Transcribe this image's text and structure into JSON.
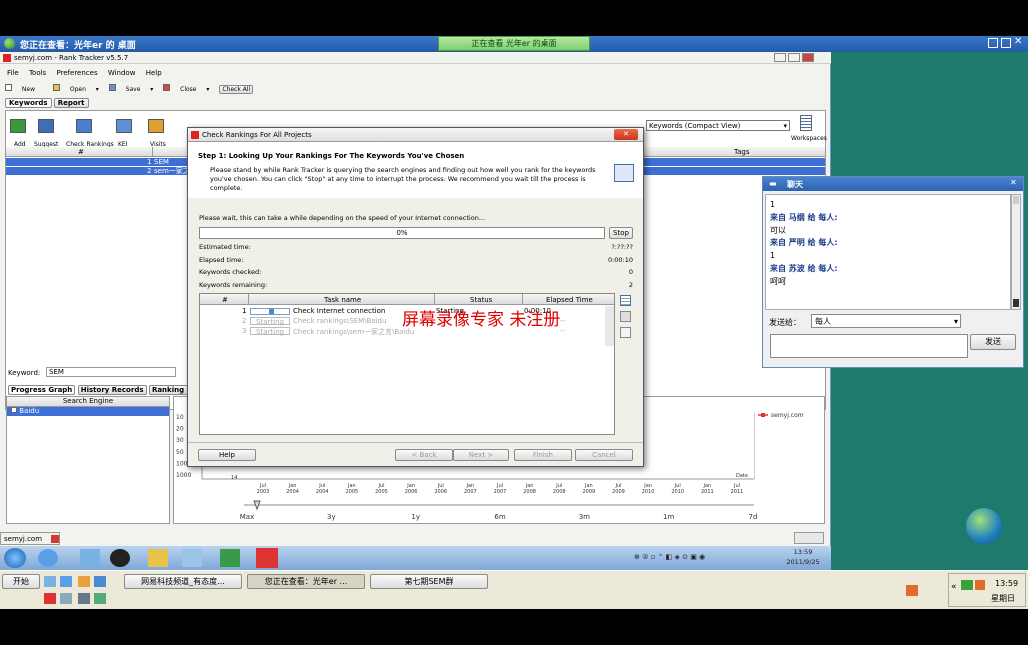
{
  "remote": {
    "title": "您正在查看：光年er 的 桌面",
    "banner": "正在查看 光年er 的桌面"
  },
  "app": {
    "title": "semyj.com - Rank Tracker v5.5.7",
    "menu": [
      "File",
      "Tools",
      "Preferences",
      "Window",
      "Help"
    ],
    "toolbar": [
      "New",
      "Open",
      "Save",
      "Close",
      "Check All"
    ],
    "tabs": [
      "Keywords",
      "Report"
    ],
    "tool_buttons": [
      "Add",
      "Suggest",
      "Check Rankings",
      "KEI",
      "Visits"
    ],
    "view_select": "Keywords (Compact View)",
    "workspaces_label": "Workspaces",
    "grid_headers": {
      "num": "#",
      "tags": "Tags"
    },
    "rows": [
      {
        "num": "1",
        "keyword": "SEM"
      },
      {
        "num": "2",
        "keyword": "sem一家之言"
      }
    ],
    "keyword_label": "Keyword:",
    "keyword_value": "SEM",
    "bottom_tabs": [
      "Progress Graph",
      "History Records",
      "Ranking Data"
    ],
    "search_engine_header": "Search Engine",
    "search_engine_item": "Baidu",
    "chart": {
      "y_ticks": [
        "10",
        "20",
        "30",
        "50",
        "100",
        "1000"
      ],
      "x_ticks": [
        [
          "Jul",
          "2003"
        ],
        [
          "Jan",
          "2004"
        ],
        [
          "Jul",
          "2004"
        ],
        [
          "Jan",
          "2005"
        ],
        [
          "Jul",
          "2005"
        ],
        [
          "Jan",
          "2006"
        ],
        [
          "Jul",
          "2006"
        ],
        [
          "Jan",
          "2007"
        ],
        [
          "Jul",
          "2007"
        ],
        [
          "Jan",
          "2008"
        ],
        [
          "Jul",
          "2008"
        ],
        [
          "Jan",
          "2009"
        ],
        [
          "Jul",
          "2009"
        ],
        [
          "Jan",
          "2010"
        ],
        [
          "Jul",
          "2010"
        ],
        [
          "Jan",
          "2011"
        ],
        [
          "Jul",
          "2011"
        ]
      ],
      "legend": "semyj.com",
      "x_axis_note": "Date",
      "range_labels": [
        "Max",
        "3y",
        "1y",
        "6m",
        "3m",
        "1m",
        "7d"
      ],
      "slider_left_value": "14"
    },
    "status_tab": "semyj.com"
  },
  "dialog": {
    "title": "Check Rankings For All Projects",
    "step_title": "Step 1: Looking Up Your Rankings For The Keywords You've Chosen",
    "description": "Please stand by while Rank Tracker is querying the search engines and finding out how well you rank for the keywords you've chosen. You can click \"Stop\" at any time to interrupt the process. We recommend you wait till the process is complete.",
    "wait_text": "Please wait, this can take a while depending on the speed of your Internet connection...",
    "progress_text": "0%",
    "progress": 0,
    "stop_label": "Stop",
    "stats": [
      {
        "label": "Estimated time:",
        "value": "?:??:??"
      },
      {
        "label": "Elapsed time:",
        "value": "0:00:10"
      },
      {
        "label": "Keywords checked:",
        "value": "0"
      },
      {
        "label": "Keywords remaining:",
        "value": "2"
      }
    ],
    "table_headers": [
      "#",
      "Task name",
      "Status",
      "Elapsed Time"
    ],
    "tasks": [
      {
        "num": "1",
        "name": "Check Internet connection",
        "status": "Starting",
        "time": "0:00:10"
      },
      {
        "num": "2",
        "name": "Check rankings\\SEM\\Baidu",
        "status": "Starting",
        "time": "--"
      },
      {
        "num": "3",
        "name": "Check rankings\\sem一家之言\\Baidu",
        "status": "Starting",
        "time": "--"
      }
    ],
    "buttons": {
      "help": "Help",
      "back": "< Back",
      "next": "Next >",
      "finish": "Finish",
      "cancel": "Cancel"
    }
  },
  "watermark": "屏幕录像专家  未注册",
  "chat": {
    "title": "聊天",
    "messages": [
      {
        "type": "text",
        "text": "1"
      },
      {
        "type": "from",
        "text": "来自 马纲 给 每人:"
      },
      {
        "type": "text",
        "text": "可以"
      },
      {
        "type": "from",
        "text": "来自 严明 给 每人:"
      },
      {
        "type": "text",
        "text": "1"
      },
      {
        "type": "from",
        "text": "来自 苏波 给 每人:"
      },
      {
        "type": "text",
        "text": "呵呵"
      }
    ],
    "send_to_label": "发送给：",
    "send_to_value": "每人",
    "send_label": "发送"
  },
  "win7": {
    "clock_time": "13:59",
    "clock_date": "2011/9/25"
  },
  "taskbar": {
    "start": "开始",
    "items": [
      "网易科技频道_有态度...",
      "您正在查看：光年er ...",
      "第七期SEM群"
    ],
    "time": "13:59",
    "weekday": "星期日"
  }
}
